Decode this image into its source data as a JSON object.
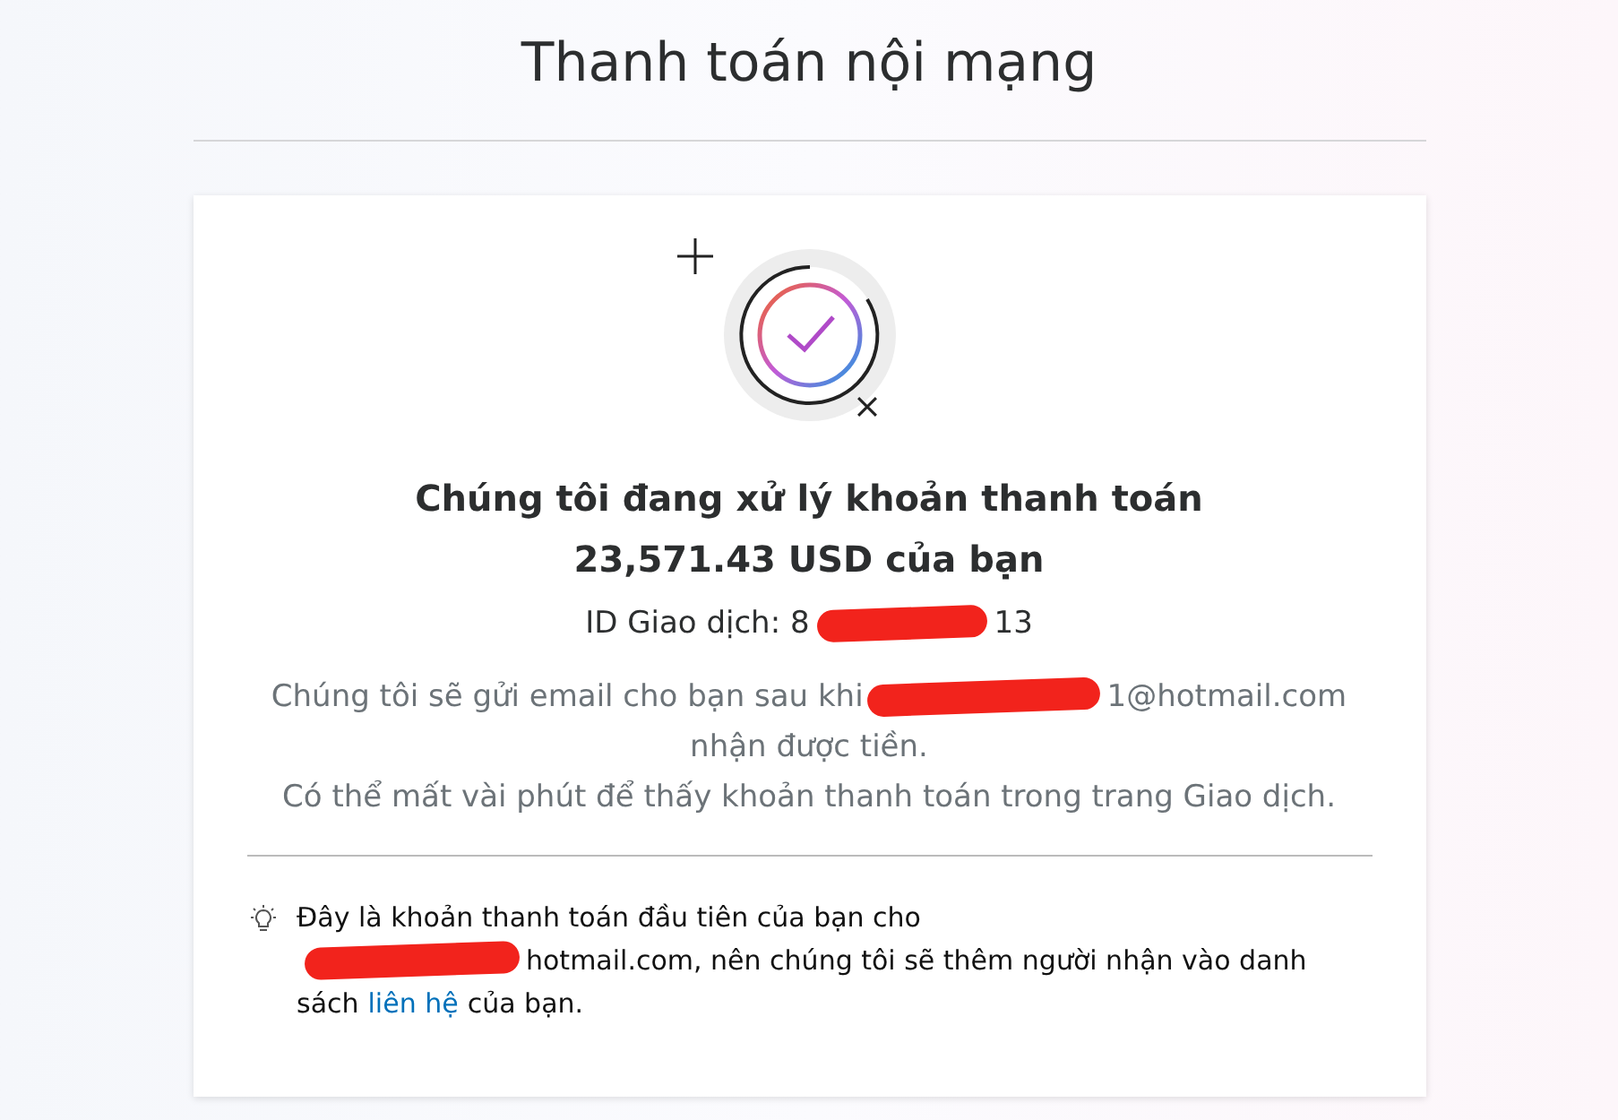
{
  "page_title": "Thanh toán nội mạng",
  "card": {
    "heading": [
      "Chúng tôi đang xử lý khoản thanh toán",
      "23,571.43 USD của bạn"
    ],
    "transaction_id": [
      {
        "kind": "text",
        "text": "ID Giao dịch: 8"
      },
      {
        "kind": "redaction"
      },
      {
        "kind": "text",
        "text": "13"
      }
    ],
    "message_lines": [
      [
        {
          "kind": "text",
          "text": "Chúng tôi sẽ gửi email cho bạn sau khi"
        },
        {
          "kind": "redaction"
        },
        {
          "kind": "text",
          "text": "1@hotmail.com"
        }
      ],
      [
        {
          "kind": "text",
          "text": "nhận được tiền."
        }
      ],
      [
        {
          "kind": "text",
          "text": "Có thể mất vài phút để thấy khoản thanh toán trong trang Giao dịch."
        }
      ]
    ],
    "note_lines": [
      [
        {
          "kind": "text",
          "text": "Đây là khoản thanh toán đầu tiên của bạn cho"
        }
      ],
      [
        {
          "kind": "redaction"
        },
        {
          "kind": "text",
          "text": "hotmail.com, nên chúng tôi sẽ thêm người nhận vào danh"
        }
      ],
      [
        {
          "kind": "text",
          "text": "sách"
        },
        {
          "kind": "link",
          "text": "liên hệ"
        },
        {
          "kind": "text",
          "text": "của bạn."
        }
      ]
    ]
  }
}
